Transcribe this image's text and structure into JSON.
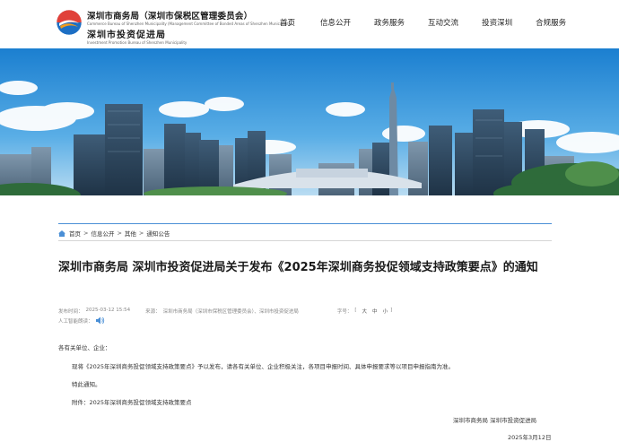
{
  "header": {
    "org_line1": "深圳市商务局（深圳市保税区管理委员会）",
    "org_sub1": "Commerce Bureau of Shenzhen Municipality (Management Committee of Bonded Areas of Shenzhen Municipality)",
    "org_line2": "深圳市投资促进局",
    "org_sub2": "Investment Promotion Bureau of Shenzhen Municipality"
  },
  "nav": {
    "items": [
      {
        "label": "首页"
      },
      {
        "label": "信息公开"
      },
      {
        "label": "政务服务"
      },
      {
        "label": "互动交流"
      },
      {
        "label": "投资深圳"
      },
      {
        "label": "合规服务"
      }
    ]
  },
  "breadcrumb": {
    "items": [
      "首页",
      "信息公开",
      "其他",
      "通知公告"
    ],
    "separator": ">"
  },
  "article": {
    "title": "深圳市商务局 深圳市投资促进局关于发布《2025年深圳商务投促领域支持政策要点》的通知",
    "publish_label": "发布时间：",
    "publish_time": "2025-03-12 15:54",
    "source_label": "来源：",
    "source": "深圳市商务局（深圳市保税区管理委员会）、深圳市投资促进局",
    "font_label": "字号：",
    "font_sizes": [
      "大",
      "中",
      "小"
    ],
    "reader_label": "人工智能朗读：",
    "salutation": "各有关单位、企业：",
    "body": "现将《2025年深圳商务投促领域支持政策要点》予以发布，请各有关单位、企业积极关注，各项目申报时间、具体申报要求等以项目申报指南为准。",
    "closing": "特此通知。",
    "attachment": "附件：2025年深圳商务投促领域支持政策要点",
    "signature": "深圳市商务局 深圳市投资促进局",
    "date": "2025年3月12日"
  },
  "colors": {
    "accent": "#4a8fd6",
    "logo_red": "#e0413a",
    "logo_blue": "#1d6fc4",
    "logo_orange": "#f29b1d"
  }
}
